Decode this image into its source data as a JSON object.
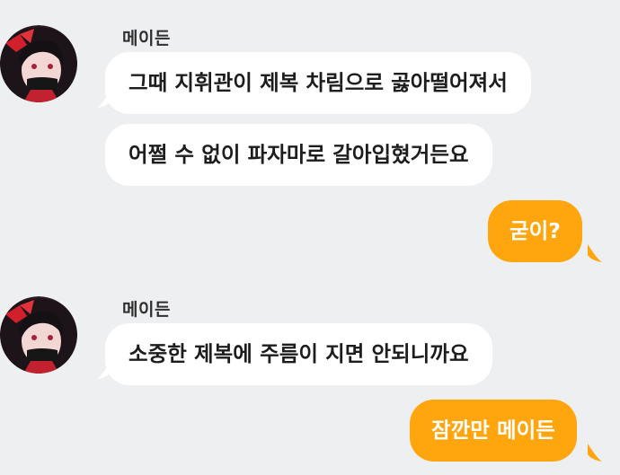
{
  "chat": {
    "messages": [
      {
        "sender": "메이든",
        "text": "그때 지휘관이 제복 차림으로 곯아떨어져서"
      },
      {
        "sender": "메이든",
        "text": "어쩔 수 없이 파자마로 갈아입혔거든요"
      },
      {
        "sender": "me",
        "text": "굳이?"
      },
      {
        "sender": "메이든",
        "text": "소중한 제복에 주름이 지면 안되니까요"
      },
      {
        "sender": "me",
        "text": "잠깐만 메이든"
      }
    ]
  },
  "colors": {
    "background": "#eeeff1",
    "incoming_bubble": "#ffffff",
    "outgoing_bubble": "#ffa50d"
  },
  "icons": {
    "avatar": "maiden-avatar-icon"
  }
}
